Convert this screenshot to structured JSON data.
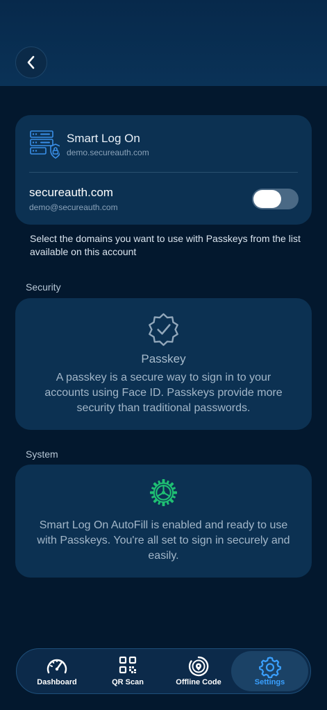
{
  "header": {
    "back_label": "Back"
  },
  "account": {
    "app_name": "Smart Log On",
    "app_domain": "demo.secureauth.com",
    "domain_name": "secureauth.com",
    "domain_email": "demo@secureauth.com",
    "toggle_state": "off"
  },
  "helper_text": "Select the domains you want to use with Passkeys from the list available on this account",
  "security": {
    "section_label": "Security",
    "title": "Passkey",
    "body": "A passkey is a secure way to sign in to your accounts using Face ID. Passkeys provide more security than traditional passwords."
  },
  "system": {
    "section_label": "System",
    "body": "Smart Log On AutoFill is enabled and ready to use with Passkeys. You're all set to sign in securely and easily."
  },
  "tabs": [
    {
      "label": "Dashboard",
      "icon": "speedometer-icon"
    },
    {
      "label": "QR Scan",
      "icon": "qr-code-icon"
    },
    {
      "label": "Offline Code",
      "icon": "location-pin-icon"
    },
    {
      "label": "Settings",
      "icon": "gear-icon",
      "active": true
    }
  ],
  "colors": {
    "background": "#03182e",
    "card": "#0c3152",
    "accent": "#3aa0ff",
    "success": "#1fbf73"
  }
}
